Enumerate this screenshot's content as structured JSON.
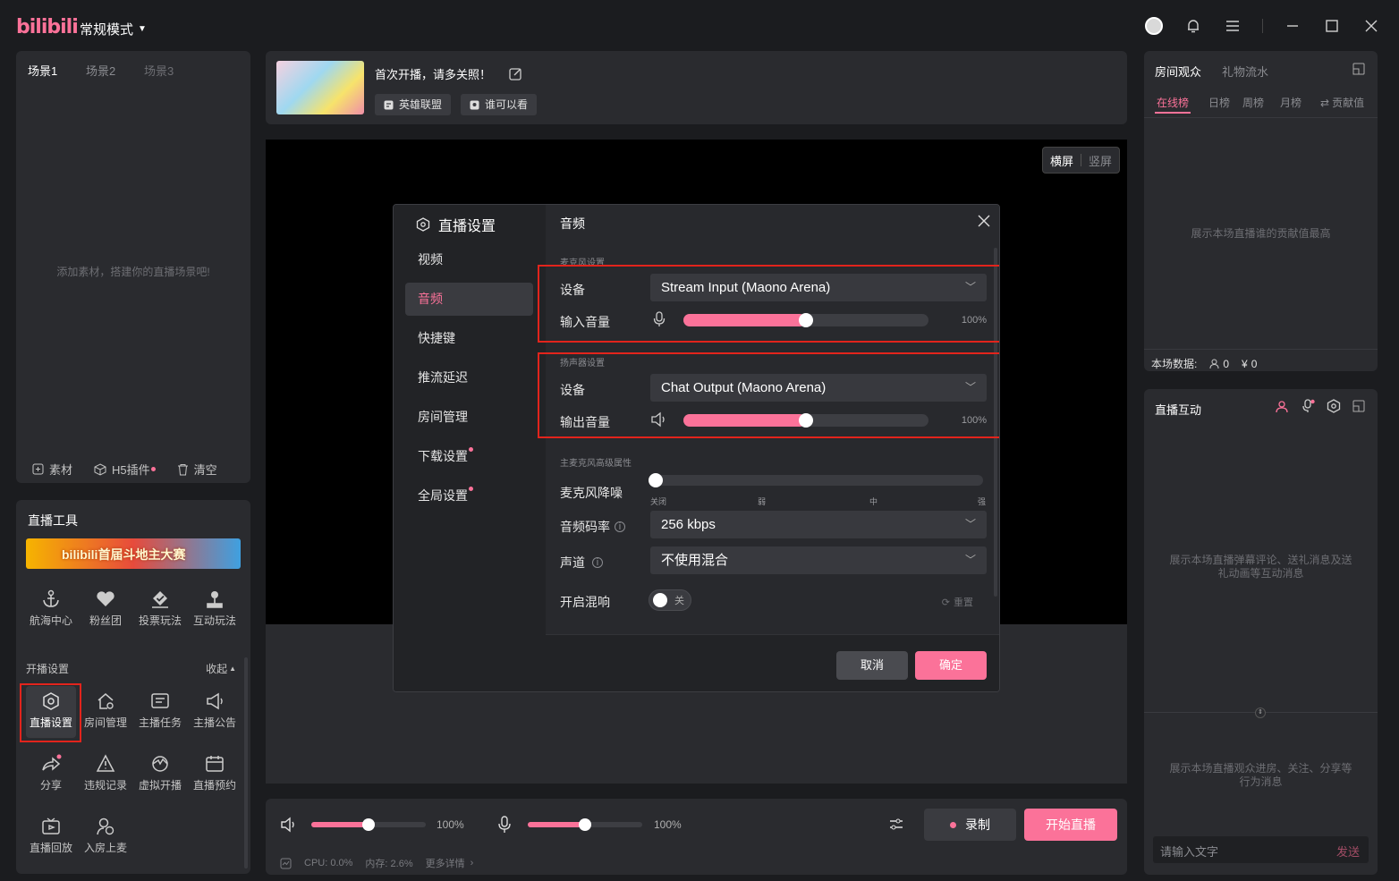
{
  "titlebar": {
    "logo": "bilibili",
    "mode": "常规模式"
  },
  "scenes": {
    "tabs": [
      "场景1",
      "场景2",
      "场景3"
    ],
    "empty": "添加素材，搭建你的直播场景吧!",
    "footer": {
      "material": "素材",
      "h5": "H5插件",
      "clear": "清空"
    }
  },
  "tools": {
    "title": "直播工具",
    "banner_text": "bilibili首届斗地主大赛",
    "row1": [
      "航海中心",
      "粉丝团",
      "投票玩法",
      "互动玩法"
    ],
    "settings_title": "开播设置",
    "collapse": "收起",
    "row2": [
      "直播设置",
      "房间管理",
      "主播任务",
      "主播公告"
    ],
    "row3": [
      "分享",
      "违规记录",
      "虚拟开播",
      "直播预约"
    ],
    "row4": [
      "直播回放",
      "入房上麦"
    ]
  },
  "stream_info": {
    "title": "首次开播，请多关照！",
    "tag_game": "英雄联盟",
    "tag_visibility": "谁可以看"
  },
  "preview": {
    "landscape": "横屏",
    "portrait": "竖屏"
  },
  "bottom": {
    "speaker_volume": 100,
    "speaker_pct": "100%",
    "speaker_slider": 0.5,
    "mic_volume": 100,
    "mic_pct": "100%",
    "mic_slider": 0.5,
    "record": "录制",
    "start": "开始直播",
    "cpu": "CPU: 0.0%",
    "mem": "内存: 2.6%",
    "more": "更多详情"
  },
  "audience": {
    "tabs": [
      "房间观众",
      "礼物流水"
    ],
    "subtabs": [
      "在线榜",
      "日榜",
      "周榜",
      "月榜",
      "贡献值"
    ],
    "empty": "展示本场直播谁的贡献值最高",
    "stats_label": "本场数据:",
    "viewers": "0",
    "revenue": "0"
  },
  "interact": {
    "title": "直播互动",
    "empty1": "展示本场直播弹幕评论、送礼消息及送礼动画等互动消息",
    "empty2": "展示本场直播观众进房、关注、分享等行为消息",
    "input_placeholder": "请输入文字",
    "send": "发送"
  },
  "modal": {
    "title": "直播设置",
    "nav": [
      "视频",
      "音频",
      "快捷键",
      "推流延迟",
      "房间管理",
      "下载设置",
      "全局设置"
    ],
    "header": "音频",
    "mic_section": "麦克风设置",
    "device_label": "设备",
    "mic_device": "Stream Input (Maono Arena)",
    "input_volume_label": "输入音量",
    "input_volume": "100%",
    "input_slider": 0.5,
    "speaker_section": "扬声器设置",
    "speaker_device": "Chat Output (Maono Arena)",
    "output_volume_label": "输出音量",
    "output_volume": "100%",
    "output_slider": 0.5,
    "adv_section": "主麦克风高级属性",
    "noise_label": "麦克风降噪",
    "noise_levels": [
      "关闭",
      "弱",
      "中",
      "强"
    ],
    "bitrate_label": "音频码率",
    "bitrate": "256 kbps",
    "channel_label": "声道",
    "channel": "不使用混合",
    "reverb_label": "开启混响",
    "reverb_state": "关",
    "reset": "重置",
    "cancel": "取消",
    "confirm": "确定"
  }
}
